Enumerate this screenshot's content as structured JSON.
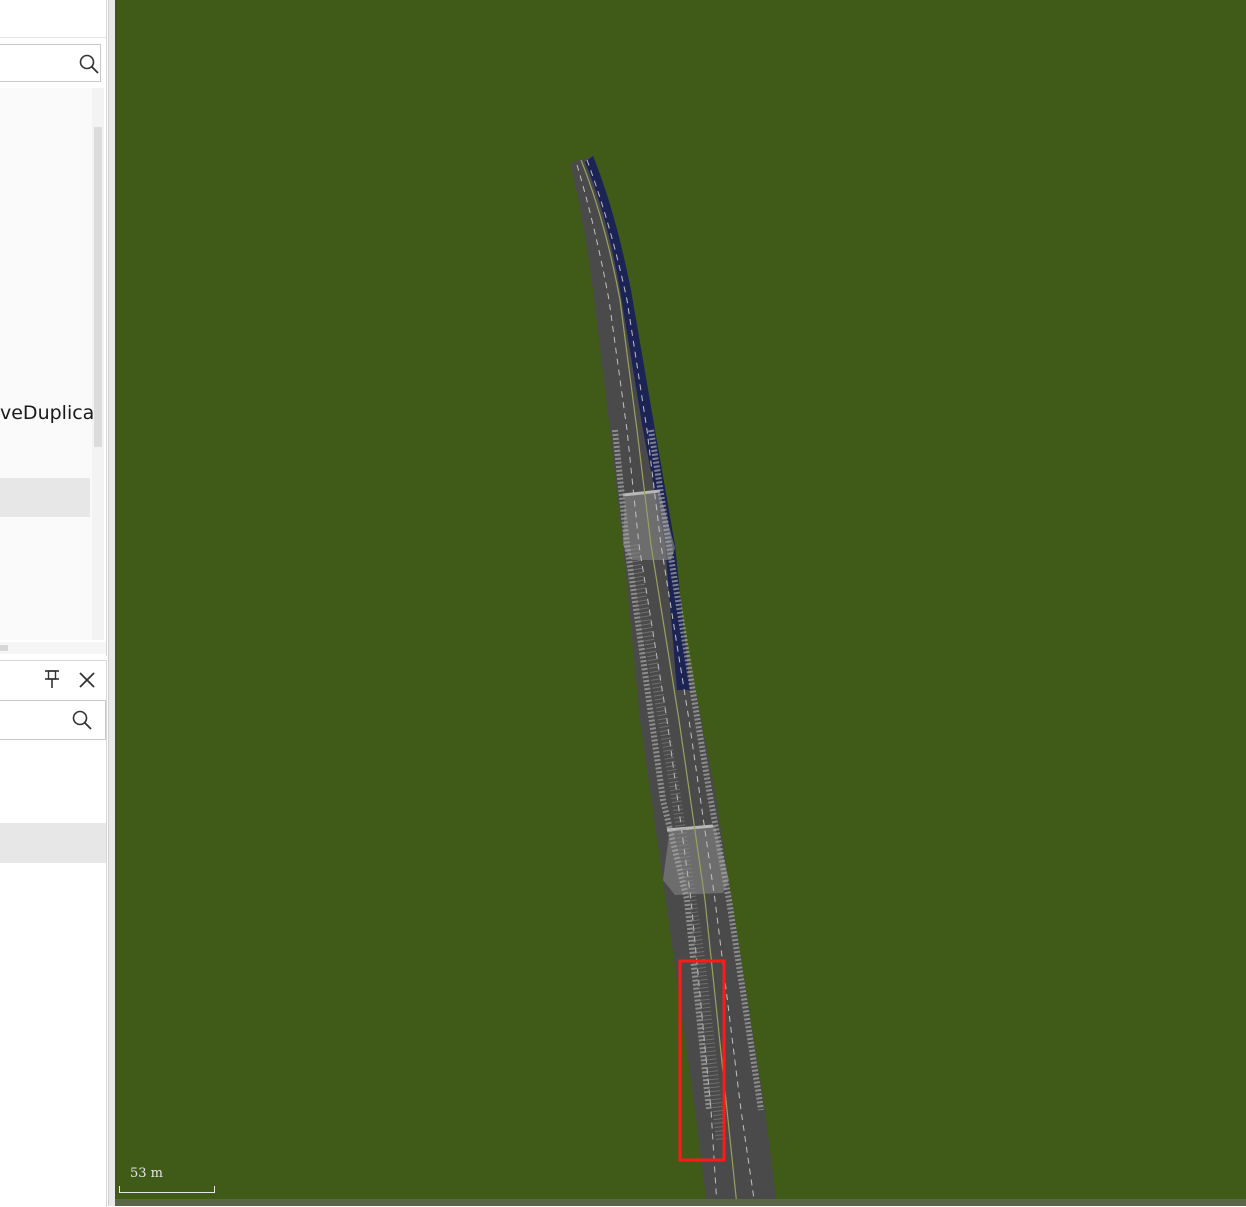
{
  "left_top_panel": {
    "list_item_partial": "veDuplica"
  },
  "icons": {
    "search": "search-icon",
    "pin": "pin-icon",
    "close": "close-icon"
  },
  "viewport": {
    "scale_label": "53 m",
    "colors": {
      "background": "#3f5b17",
      "road": "#4a4a4a",
      "lane_markings": "#b8b8b8",
      "selection_box": "#ff1a1a",
      "highlight_lane": "#1c2355"
    }
  }
}
